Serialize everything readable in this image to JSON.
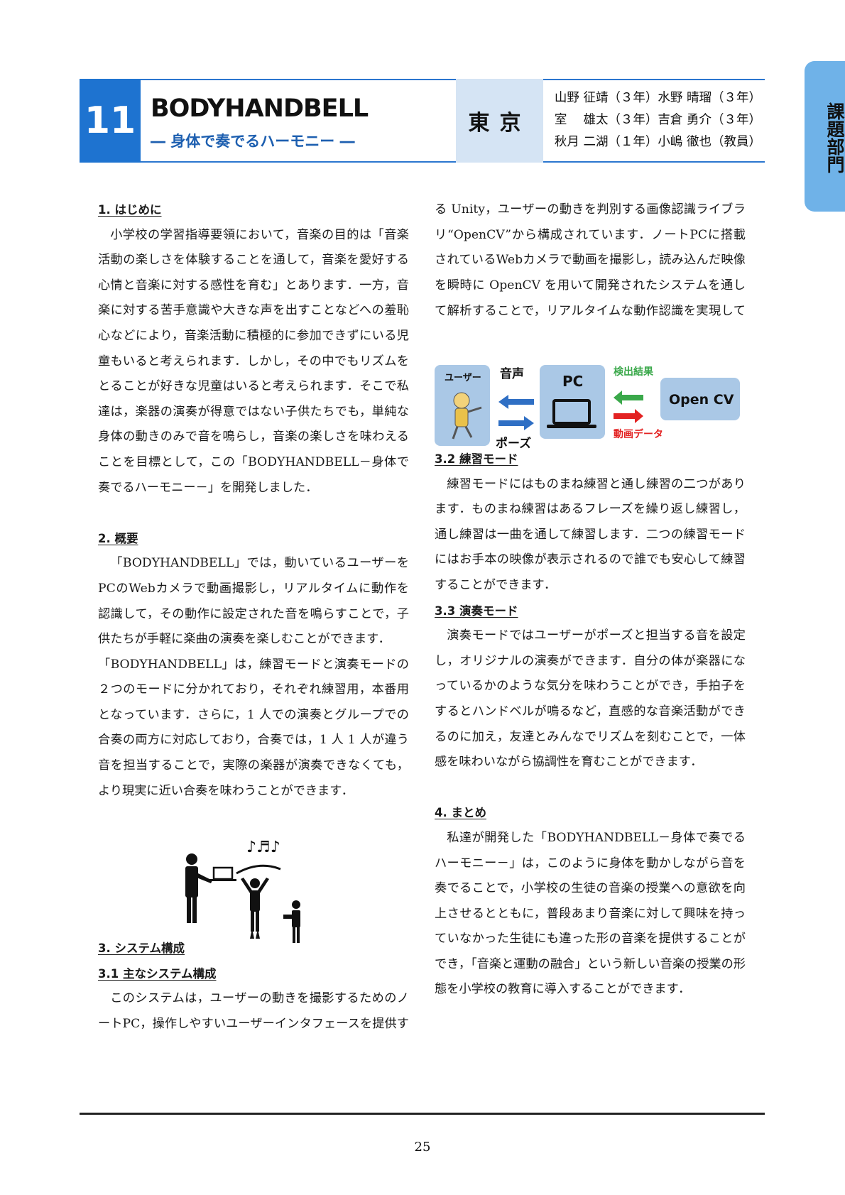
{
  "side_tab": {
    "label": "課題部門",
    "color": "#6fb2e8"
  },
  "header": {
    "number": "11",
    "title": "BODYHANDBELL",
    "subtitle": "― 身体で奏でるハーモニー ―",
    "region": "東京",
    "members": [
      "山野 征靖（３年）水野 晴瑠（３年）",
      "室　 雄太（３年）吉倉 勇介（３年）",
      "秋月 二湖（１年）小嶋 徹也（教員）"
    ],
    "accent_color": "#1e73d0",
    "region_bg": "#d5e4f4"
  },
  "sections": {
    "intro": {
      "heading": "1. はじめに",
      "paragraph": "小学校の学習指導要領において，音楽の目的は「音楽活動の楽しさを体験することを通して，音楽を愛好する心情と音楽に対する感性を育む」とあります．一方，音楽に対する苦手意識や大きな声を出すことなどへの羞恥心などにより，音楽活動に積極的に参加できずにいる児童もいると考えられます．しかし，その中でもリズムをとることが好きな児童はいると考えられます．そこで私達は，楽器の演奏が得意ではない子供たちでも，単純な身体の動きのみで音を鳴らし，音楽の楽しさを味わえることを目標として，この「BODYHANDBELL－身体で奏でるハーモニー－」を開発しました．"
    },
    "overview": {
      "heading": "2. 概要",
      "paragraph1": "「BODYHANDBELL」では，動いているユーザーをPCのWebカメラで動画撮影し，リアルタイムに動作を認識して，その動作に設定された音を鳴らすことで，子供たちが手軽に楽曲の演奏を楽しむことができます．",
      "paragraph2": "「BODYHANDBELL」は，練習モードと演奏モードの２つのモードに分かれており，それぞれ練習用，本番用となっています．さらに，1 人での演奏とグループでの合奏の両方に対応しており，合奏では，1 人 1 人が違う音を担当することで，実際の楽器が演奏できなくても，より現実に近い合奏を味わうことができます．"
    },
    "system": {
      "heading": "3. システム構成",
      "sub_heading": "3.1 主なシステム構成",
      "paragraph": "このシステムは，ユーザーの動きを撮影するためのノートPC，操作しやすいユーザーインタフェースを提供する Unity，ユーザーの動きを判別する画像認識ライブラリ“OpenCV”から構成されています．ノートPCに搭載されているWebカメラで動画を撮影し，読み込んだ映像を瞬時に OpenCV を用いて開発されたシステムを通して解析することで，リアルタイムな動作認識を実現しています．"
    },
    "practice": {
      "heading": "3.2 練習モード",
      "paragraph": "練習モードにはものまね練習と通し練習の二つがあります．ものまね練習はあるフレーズを繰り返し練習し，通し練習は一曲を通して練習します．二つの練習モードにはお手本の映像が表示されるので誰でも安心して練習することができます．"
    },
    "performance": {
      "heading": "3.3 演奏モード",
      "paragraph": "演奏モードではユーザーがポーズと担当する音を設定し，オリジナルの演奏ができます．自分の体が楽器になっているかのような気分を味わうことができ，手拍子をするとハンドベルが鳴るなど，直感的な音楽活動ができるのに加え，友達とみんなでリズムを刻むことで，一体感を味わいながら協調性を育むことができます．"
    },
    "summary": {
      "heading": "4. まとめ",
      "paragraph": "私達が開発した「BODYHANDBELL－身体で奏でるハーモニー－」は，このように身体を動かしながら音を奏でることで，小学校の生徒の音楽の授業への意欲を向上させるとともに，普段あまり音楽に対して興味を持っていなかった生徒にも違った形の音楽を提供することができ，「音楽と運動の融合」という新しい音楽の授業の形態を小学校の教育に導入することができます．"
    }
  },
  "diagram": {
    "user_label": "ユーザー",
    "voice_label": "音声",
    "pose_label": "ポーズ",
    "pc_label": "PC",
    "detect_label": "検出結果",
    "video_label": "動画データ",
    "opencv_label": "Open CV",
    "box_color": "#aac8e6",
    "arrow_blue": "#2f6fc4",
    "arrow_green": "#3aa84a",
    "arrow_red": "#e32222"
  },
  "footer": {
    "page_number": "25"
  }
}
